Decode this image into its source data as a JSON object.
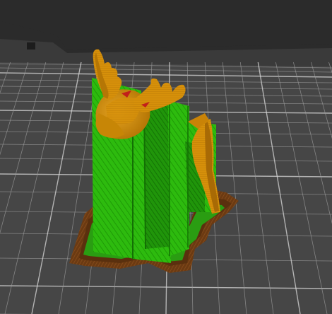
{
  "viewport": {
    "kind": "3D slicer preview",
    "background_color": "#2b2b2b",
    "bed_color": "#464646",
    "bed_frame_color": "#3a3a3a",
    "grid_line_color": "#9a9a9a",
    "grid_major_color": "#d8d8d8"
  },
  "model": {
    "subject": "moose figurine",
    "support_color": "#2dbb0e",
    "support_dark_color": "#1d8a06",
    "model_color": "#d6900a",
    "model_shadow_color": "#a86a05",
    "brim_color": "#6b3a12",
    "accent_color": "#c2201a"
  }
}
